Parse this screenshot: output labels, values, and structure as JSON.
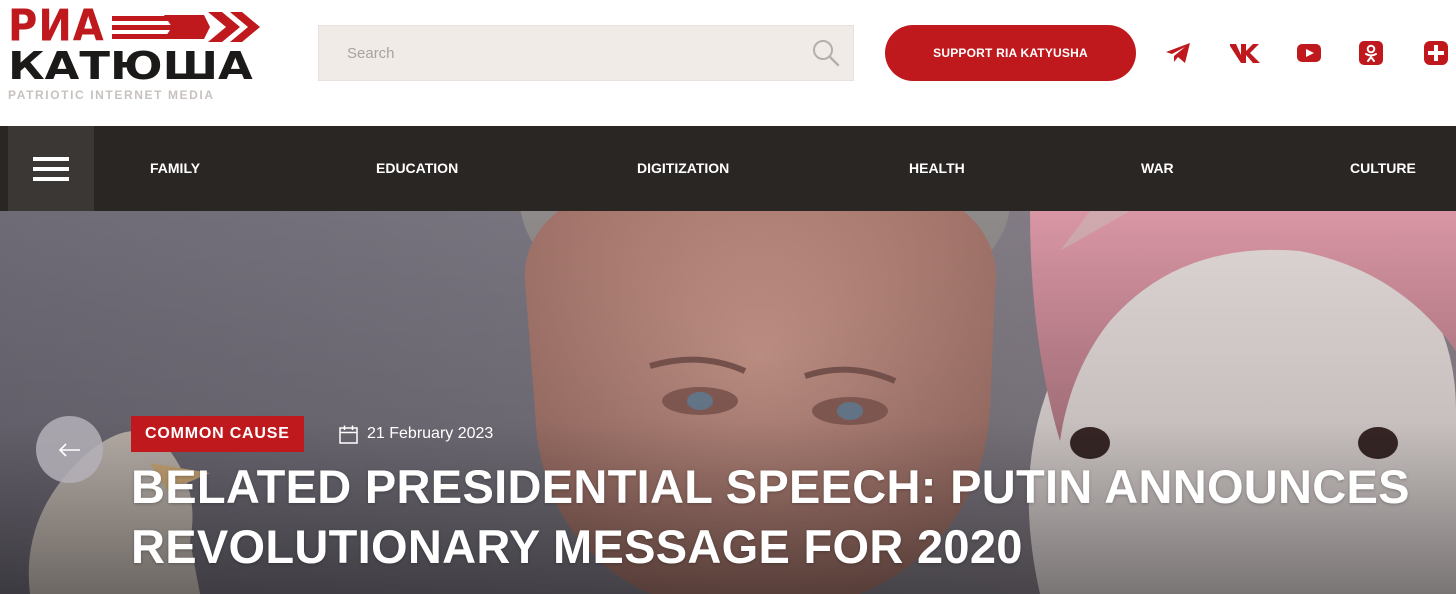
{
  "header": {
    "logo": {
      "line1": "РИА",
      "line2": "КАТЮША",
      "tagline": "PATRIOTIC INTERNET MEDIA"
    },
    "search": {
      "placeholder": "Search",
      "value": "",
      "icon": "search-icon"
    },
    "support_label": "SUPPORT RIA KATYUSHA",
    "social_icons": [
      "telegram-icon",
      "vk-icon",
      "youtube-icon",
      "odnoklassniki-icon",
      "rutube-icon"
    ]
  },
  "nav": {
    "menu_icon": "hamburger-menu-icon",
    "items": [
      "FAMILY",
      "EDUCATION",
      "DIGITIZATION",
      "HEALTH",
      "WAR",
      "CULTURE"
    ]
  },
  "article": {
    "category": "COMMON CAUSE",
    "date": "21 February 2023",
    "date_icon": "calendar-icon",
    "back_icon": "arrow-left-icon",
    "headline": "BELATED PRESIDENTIAL SPEECH: PUTIN ANNOUNCES REVOLUTIONARY MESSAGE FOR 2020"
  },
  "colors": {
    "brand_red": "#c0191d",
    "nav_bg": "#2a2624",
    "logo_dark": "#1c1a19",
    "search_bg": "#f1ebe8"
  }
}
